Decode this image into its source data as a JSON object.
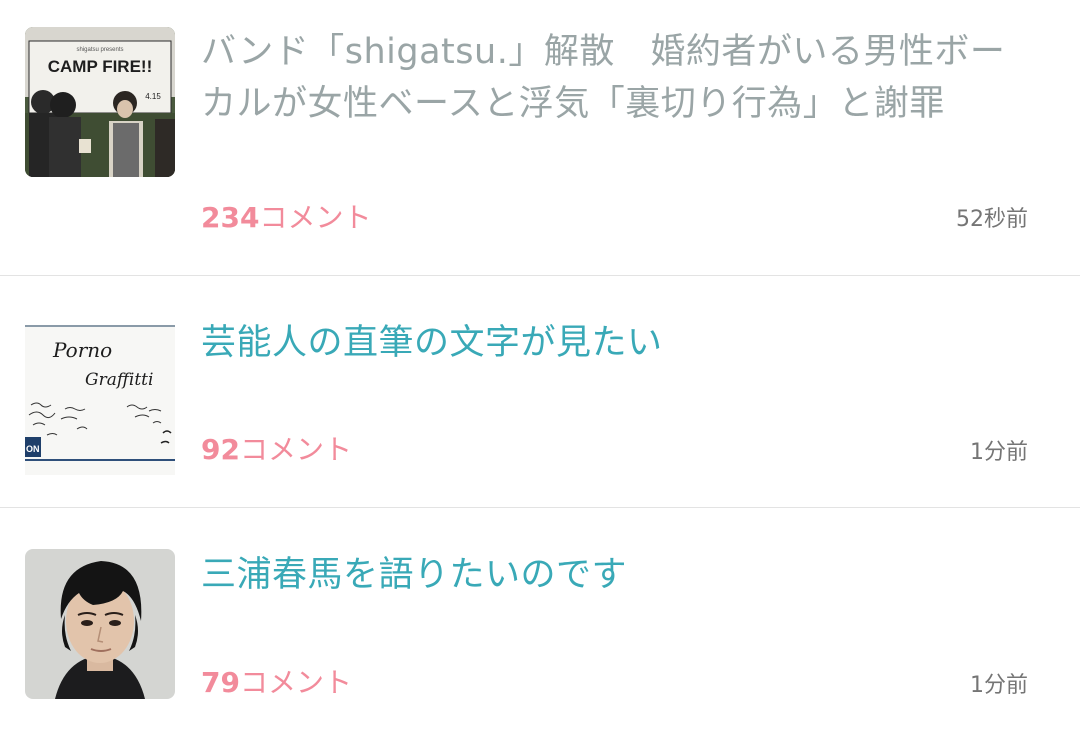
{
  "topics": [
    {
      "title": "バンド「shigatsu.」解散　婚約者がいる男性ボーカルが女性ベースと浮気「裏切り行為」と謝罪",
      "comment_count": "234",
      "comment_suffix": "コメント",
      "time": "52秒前",
      "visited": true,
      "thumbnail": {
        "kind": "band-photo",
        "sign_text": "CAMP FIRE!!",
        "sign_small": "shigatsu presents",
        "sign_date": "4.15"
      }
    },
    {
      "title": "芸能人の直筆の文字が見たい",
      "comment_count": "92",
      "comment_suffix": "コメント",
      "time": "1分前",
      "visited": false,
      "thumbnail": {
        "kind": "handwriting",
        "script_line1": "Porno",
        "script_line2": "Graffitti",
        "edge_text": "ON"
      }
    },
    {
      "title": "三浦春馬を語りたいのです",
      "comment_count": "79",
      "comment_suffix": "コメント",
      "time": "1分前",
      "visited": false,
      "thumbnail": {
        "kind": "portrait"
      }
    }
  ],
  "colors": {
    "title_unread": "#39a9b7",
    "title_read": "#9aa5a6",
    "comment": "#f28b9b",
    "time": "#757575",
    "divider": "#e3e3e3"
  }
}
